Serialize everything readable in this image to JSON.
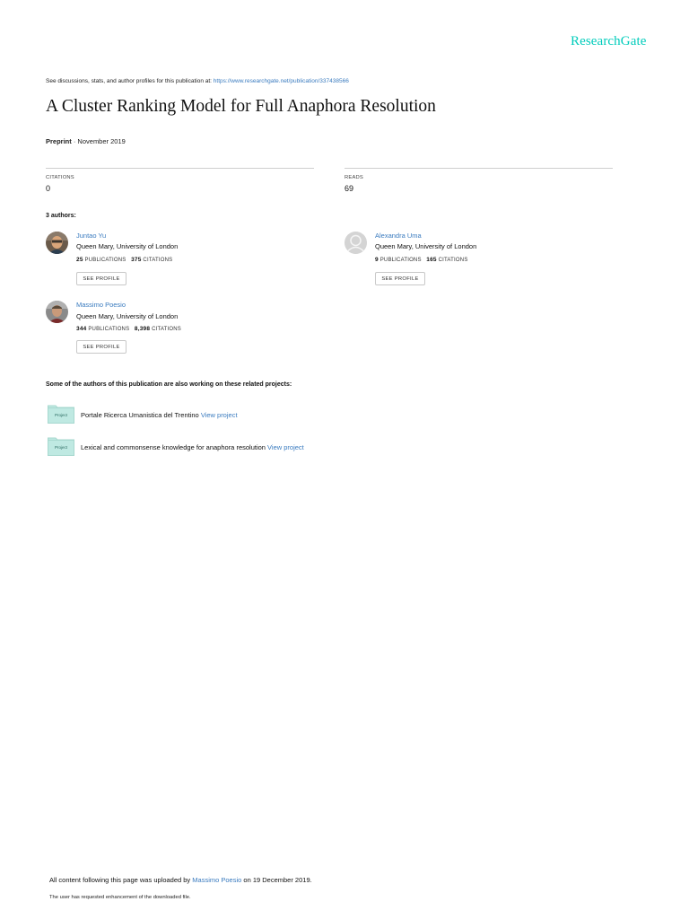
{
  "brand": "ResearchGate",
  "discussion": {
    "prefix": "See discussions, stats, and author profiles for this publication at: ",
    "url": "https://www.researchgate.net/publication/337438566"
  },
  "paper": {
    "title": "A Cluster Ranking Model for Full Anaphora Resolution",
    "type": "Preprint",
    "date": " · November 2019"
  },
  "stats": {
    "citations_label": "CITATIONS",
    "citations_value": "0",
    "reads_label": "READS",
    "reads_value": "69"
  },
  "authors_heading": "3 authors:",
  "authors": [
    {
      "name": "Juntao Yu",
      "institution": "Queen Mary, University of London",
      "publications": "25",
      "publications_label": "PUBLICATIONS",
      "citations": "375",
      "citations_label": "CITATIONS",
      "button": "SEE PROFILE",
      "avatar": "photo"
    },
    {
      "name": "Alexandra Uma",
      "institution": "Queen Mary, University of London",
      "publications": "9",
      "publications_label": "PUBLICATIONS",
      "citations": "165",
      "citations_label": "CITATIONS",
      "button": "SEE PROFILE",
      "avatar": "placeholder-user-icon"
    },
    {
      "name": "Massimo Poesio",
      "institution": "Queen Mary, University of London",
      "publications": "344",
      "publications_label": "PUBLICATIONS",
      "citations": "8,398",
      "citations_label": "CITATIONS",
      "button": "SEE PROFILE",
      "avatar": "photo"
    }
  ],
  "projects_heading": "Some of the authors of this publication are also working on these related projects:",
  "projects": [
    {
      "icon_label": "Project",
      "text": "Portale Ricerca Umanistica del Trentino ",
      "link": "View project"
    },
    {
      "icon_label": "Project",
      "text": "Lexical and commonsense knowledge for anaphora resolution ",
      "link": "View project"
    }
  ],
  "footer": {
    "upload_prefix": "All content following this page was uploaded by ",
    "uploader": "Massimo Poesio",
    "upload_suffix": " on 19 December 2019.",
    "enhancement": "The user has requested enhancement of the downloaded file."
  },
  "colors": {
    "brand": "#00ccbb",
    "link": "#3a7bbf",
    "project_icon": "#bfe9e2"
  }
}
